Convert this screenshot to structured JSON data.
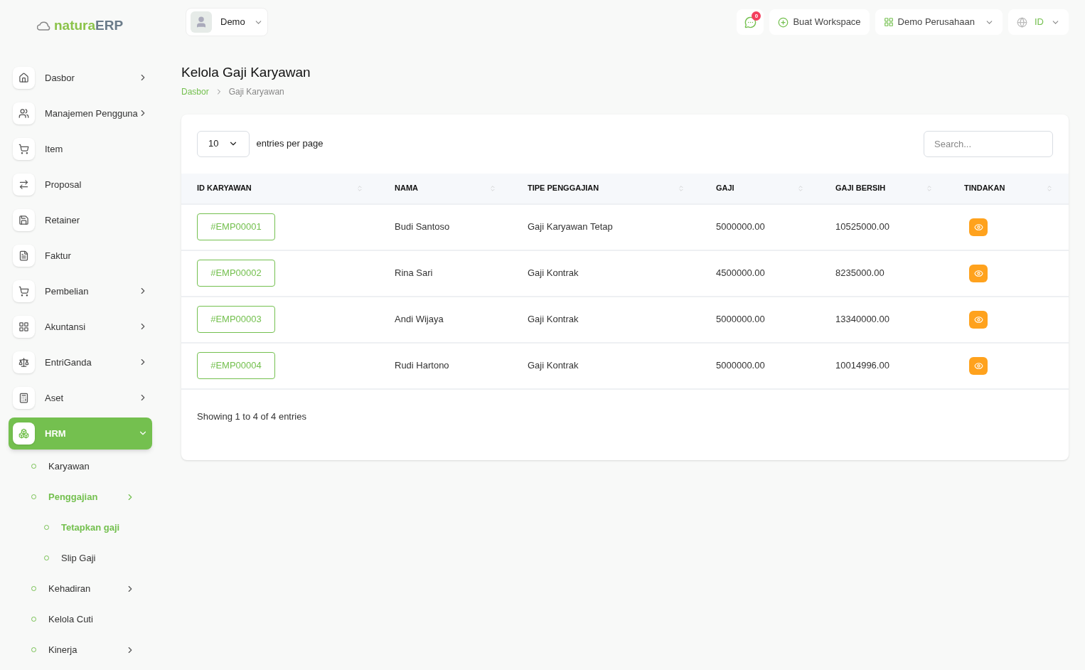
{
  "logo": {
    "brand": "natura",
    "suffix": "ERP"
  },
  "user_menu": {
    "label": "Demo"
  },
  "topbar": {
    "notifications": "0",
    "workspace_button": "Buat Workspace",
    "company": "Demo Perusahaan",
    "language": "ID"
  },
  "sidebar": {
    "items": [
      {
        "label": "Dasbor",
        "has_arrow": true,
        "selected": false
      },
      {
        "label": "Manajemen Pengguna",
        "has_arrow": true,
        "selected": false
      },
      {
        "label": "Item",
        "has_arrow": false,
        "selected": false
      },
      {
        "label": "Proposal",
        "has_arrow": false,
        "selected": false
      },
      {
        "label": "Retainer",
        "has_arrow": false,
        "selected": false
      },
      {
        "label": "Faktur",
        "has_arrow": false,
        "selected": false
      },
      {
        "label": "Pembelian",
        "has_arrow": true,
        "selected": false
      },
      {
        "label": "Akuntansi",
        "has_arrow": true,
        "selected": false
      },
      {
        "label": "EntriGanda",
        "has_arrow": true,
        "selected": false
      },
      {
        "label": "Aset",
        "has_arrow": true,
        "selected": false
      },
      {
        "label": "HRM",
        "has_arrow": true,
        "selected": true,
        "expanded": true,
        "children": [
          {
            "label": "Karyawan",
            "has_arrow": false,
            "selected": false
          },
          {
            "label": "Penggajian",
            "has_arrow": true,
            "selected": true,
            "children": [
              {
                "label": "Tetapkan gaji",
                "has_arrow": false,
                "selected": true
              },
              {
                "label": "Slip Gaji",
                "has_arrow": false,
                "selected": false
              }
            ]
          },
          {
            "label": "Kehadiran",
            "has_arrow": true,
            "selected": false
          },
          {
            "label": "Kelola Cuti",
            "has_arrow": false,
            "selected": false
          },
          {
            "label": "Kinerja",
            "has_arrow": true,
            "selected": false
          }
        ]
      }
    ]
  },
  "page": {
    "title": "Kelola Gaji Karyawan",
    "breadcrumb": [
      "Dasbor",
      "Gaji Karyawan"
    ]
  },
  "table_controls": {
    "page_size": "10",
    "page_size_label": "entries per page",
    "search_placeholder": "Search..."
  },
  "table": {
    "columns": [
      "ID KARYAWAN",
      "NAMA",
      "TIPE PENGGAJIAN",
      "GAJI",
      "GAJI BERSIH",
      "TINDAKAN"
    ],
    "rows": [
      {
        "id": "#EMP00001",
        "name": "Budi Santoso",
        "type": "Gaji Karyawan Tetap",
        "salary": "5000000.00",
        "net": "10525000.00"
      },
      {
        "id": "#EMP00002",
        "name": "Rina Sari",
        "type": "Gaji Kontrak",
        "salary": "4500000.00",
        "net": "8235000.00"
      },
      {
        "id": "#EMP00003",
        "name": "Andi Wijaya",
        "type": "Gaji Kontrak",
        "salary": "5000000.00",
        "net": "13340000.00"
      },
      {
        "id": "#EMP00004",
        "name": "Rudi Hartono",
        "type": "Gaji Kontrak",
        "salary": "5000000.00",
        "net": "10014996.00"
      }
    ]
  },
  "footer": {
    "summary": "Showing 1 to 4 of 4 entries"
  }
}
